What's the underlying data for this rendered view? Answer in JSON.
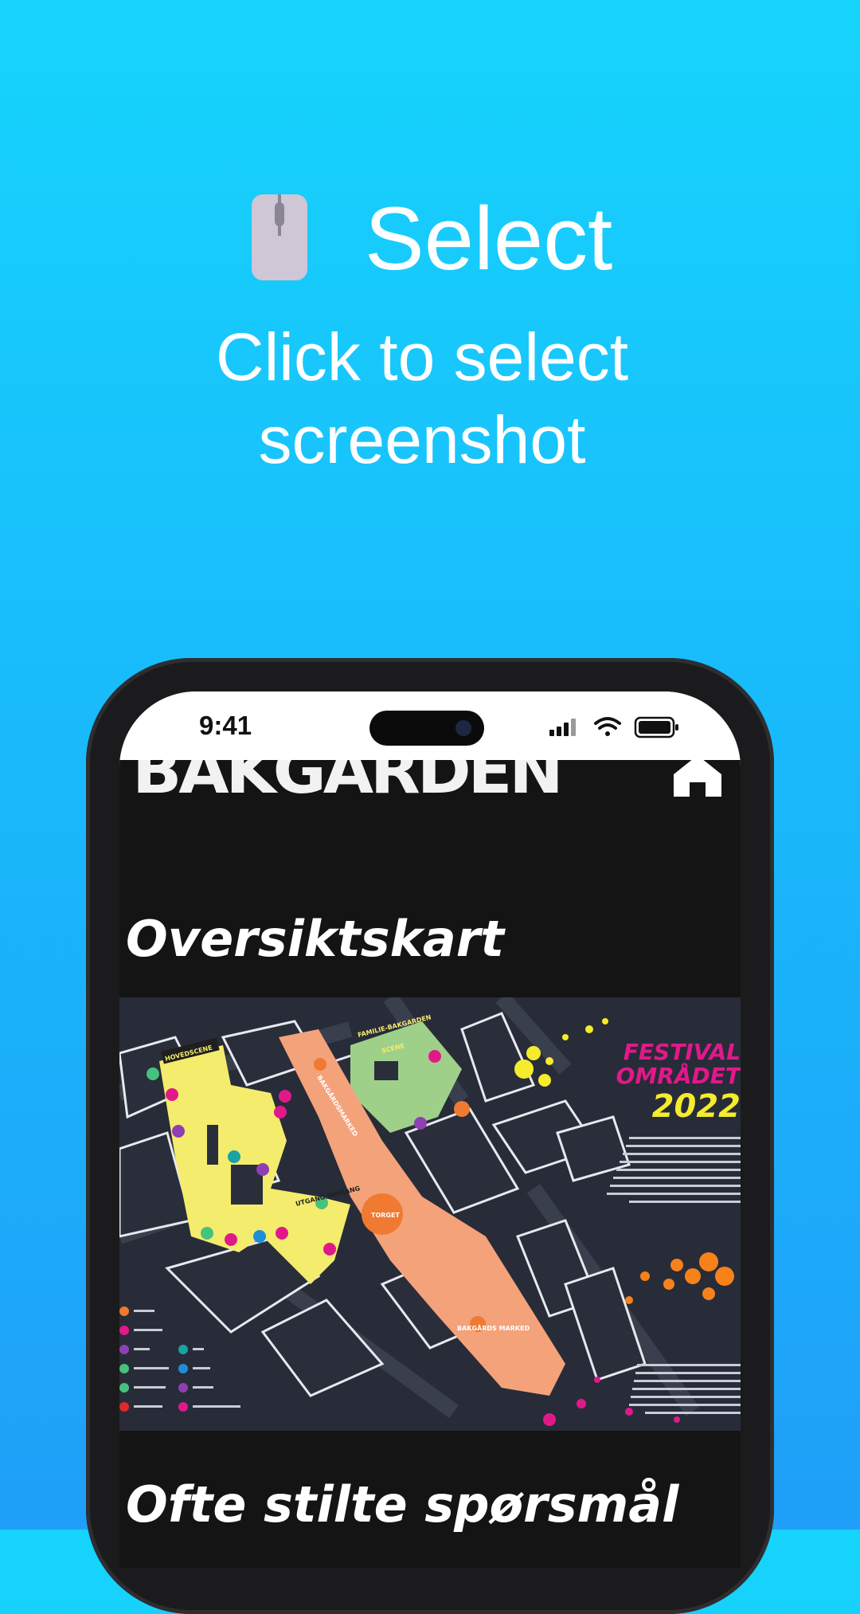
{
  "promo": {
    "icon": "mouse-icon",
    "headline": "Select",
    "subline": "Click to select screenshot"
  },
  "status_bar": {
    "time": "9:41",
    "icons": [
      "cellular-signal-icon",
      "wifi-icon",
      "battery-icon"
    ]
  },
  "app": {
    "logo_text": "BAKGARDEN",
    "home_icon": "home-icon",
    "section_map_title": "Oversiktskart",
    "section_faq_title": "Ofte stilte spørsmål",
    "map": {
      "title_line1": "FESTIVAL",
      "title_line2": "OMRÅDET",
      "year": "2022",
      "labels": {
        "hovedscene": "HOVEDSCENE",
        "scene": "SCENE",
        "familie": "FAMILIE-BAKGARDEN",
        "bakgardsmarked": "BAKGÅRDSMARKED",
        "torget": "TORGET",
        "utgang": "UTGANG INNGANG",
        "bakgards_marked": "BAKGÅRDS MARKED"
      }
    }
  },
  "colors": {
    "background_top": "#16d4fc",
    "background_bottom": "#1f9ff8",
    "app_background": "#141414",
    "map_background": "#282c38",
    "map_yellow": "#f4ec6c",
    "map_orange": "#f4a27a",
    "map_green": "#9fd08a",
    "map_magenta": "#e0198a",
    "map_title_yellow": "#f4ec2c"
  }
}
